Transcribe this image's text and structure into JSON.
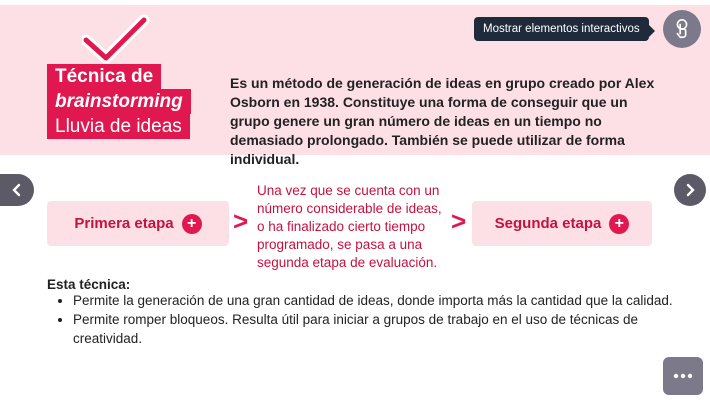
{
  "header": {
    "title_line1": "Técnica de",
    "title_line2": "brainstorming",
    "title_line3": "Lluvia de ideas",
    "description": "Es un método de generación de ideas en grupo creado por Alex Osborn en 1938. Constituye una forma de conseguir que un grupo genere un gran número de ideas en un tiempo no demasiado prolongado. También se puede utilizar de forma individual."
  },
  "tooltip": {
    "label": "Mostrar elementos interactivos"
  },
  "stages": {
    "first_label": "Primera etapa",
    "second_label": "Segunda etapa",
    "middle_text": "Una vez que se cuenta con un número considerable de ideas, o ha finalizado cierto tiempo programado, se pasa a una segunda etapa de evaluación."
  },
  "technique": {
    "heading": "Esta técnica:",
    "items": [
      "Permite la generación de una gran cantidad de ideas, donde importa más la cantidad que la calidad.",
      "Permite romper bloqueos. Resulta útil para iniciar a grupos de trabajo en el uso de técnicas de creatividad."
    ]
  },
  "icons": {
    "check": "checkmark-icon",
    "interact": "hand-pointer-icon",
    "prev": "chevron-left-icon",
    "next": "chevron-right-icon",
    "plus": "plus-icon",
    "more": "more-dots-icon",
    "arrow": "chevron-right-small-icon"
  },
  "colors": {
    "accent": "#e0184f",
    "banner_bg": "#fde0e6",
    "accent_text": "#c4123f",
    "button_gray": "#7c7a8a",
    "tooltip_bg": "#1f2a3a"
  }
}
